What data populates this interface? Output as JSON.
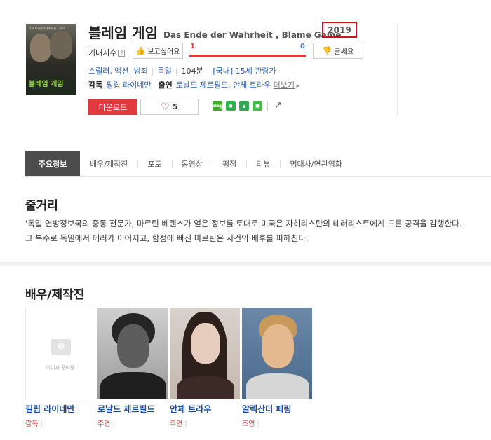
{
  "movie": {
    "poster_title": "블레임 게임",
    "poster_tagline": "다크 트와일라잇 베를린 느와르",
    "title_ko": "블레임 게임",
    "title_original": "Das Ende der Wahrheit , Blame Game",
    "year": "2019",
    "expectation_label": "기대지수",
    "want_label": "보고싶어요",
    "want_count": "1",
    "meh_count": "0",
    "meh_label": "글쎄요",
    "vote_ratio": 1.0,
    "genres": "스릴러, 액션, 범죄",
    "country": "독일",
    "runtime": "104분",
    "rating": "[국내] 15세 관람가",
    "director_label": "감독",
    "director": "필립 라이네만",
    "cast_label": "출연",
    "cast_list": "로날드 제르필드, 안체 트라우",
    "more_label": "더보기",
    "download_label": "다운로드",
    "like_count": "5",
    "share_icons": [
      {
        "name": "blog",
        "label": "blog",
        "color": "#3fae29"
      },
      {
        "name": "kakao",
        "label": "",
        "color": "#2bb24c"
      },
      {
        "name": "twitter",
        "label": "",
        "color": "#35a853"
      },
      {
        "name": "facebook",
        "label": "",
        "color": "#47b84a"
      }
    ]
  },
  "tabs": [
    "주요정보",
    "배우/제작진",
    "포토",
    "동영상",
    "평점",
    "리뷰",
    "명대사/연관영화"
  ],
  "synopsis": {
    "heading": "줄거리",
    "text": "'독일 연방정보국의 중동 전문가, 마르틴 베렌스가 얻은 정보를 토대로 미국은 자히리스탄의 테러리스트에게 드론 공격을 감행한다. 그 복수로 독일에서 테러가 이어지고, 함정에 빠진 마르틴은 사건의 배후를 파헤친다."
  },
  "cast_section": {
    "heading": "배우/제작진",
    "no_image_text": "이미지 준비중",
    "people": [
      {
        "name": "필립 라이네만",
        "role": "감독"
      },
      {
        "name": "로날드 제르필드",
        "role": "주연"
      },
      {
        "name": "안체 트라우",
        "role": "주연"
      },
      {
        "name": "알렉산더 페링",
        "role": "조연"
      }
    ]
  }
}
